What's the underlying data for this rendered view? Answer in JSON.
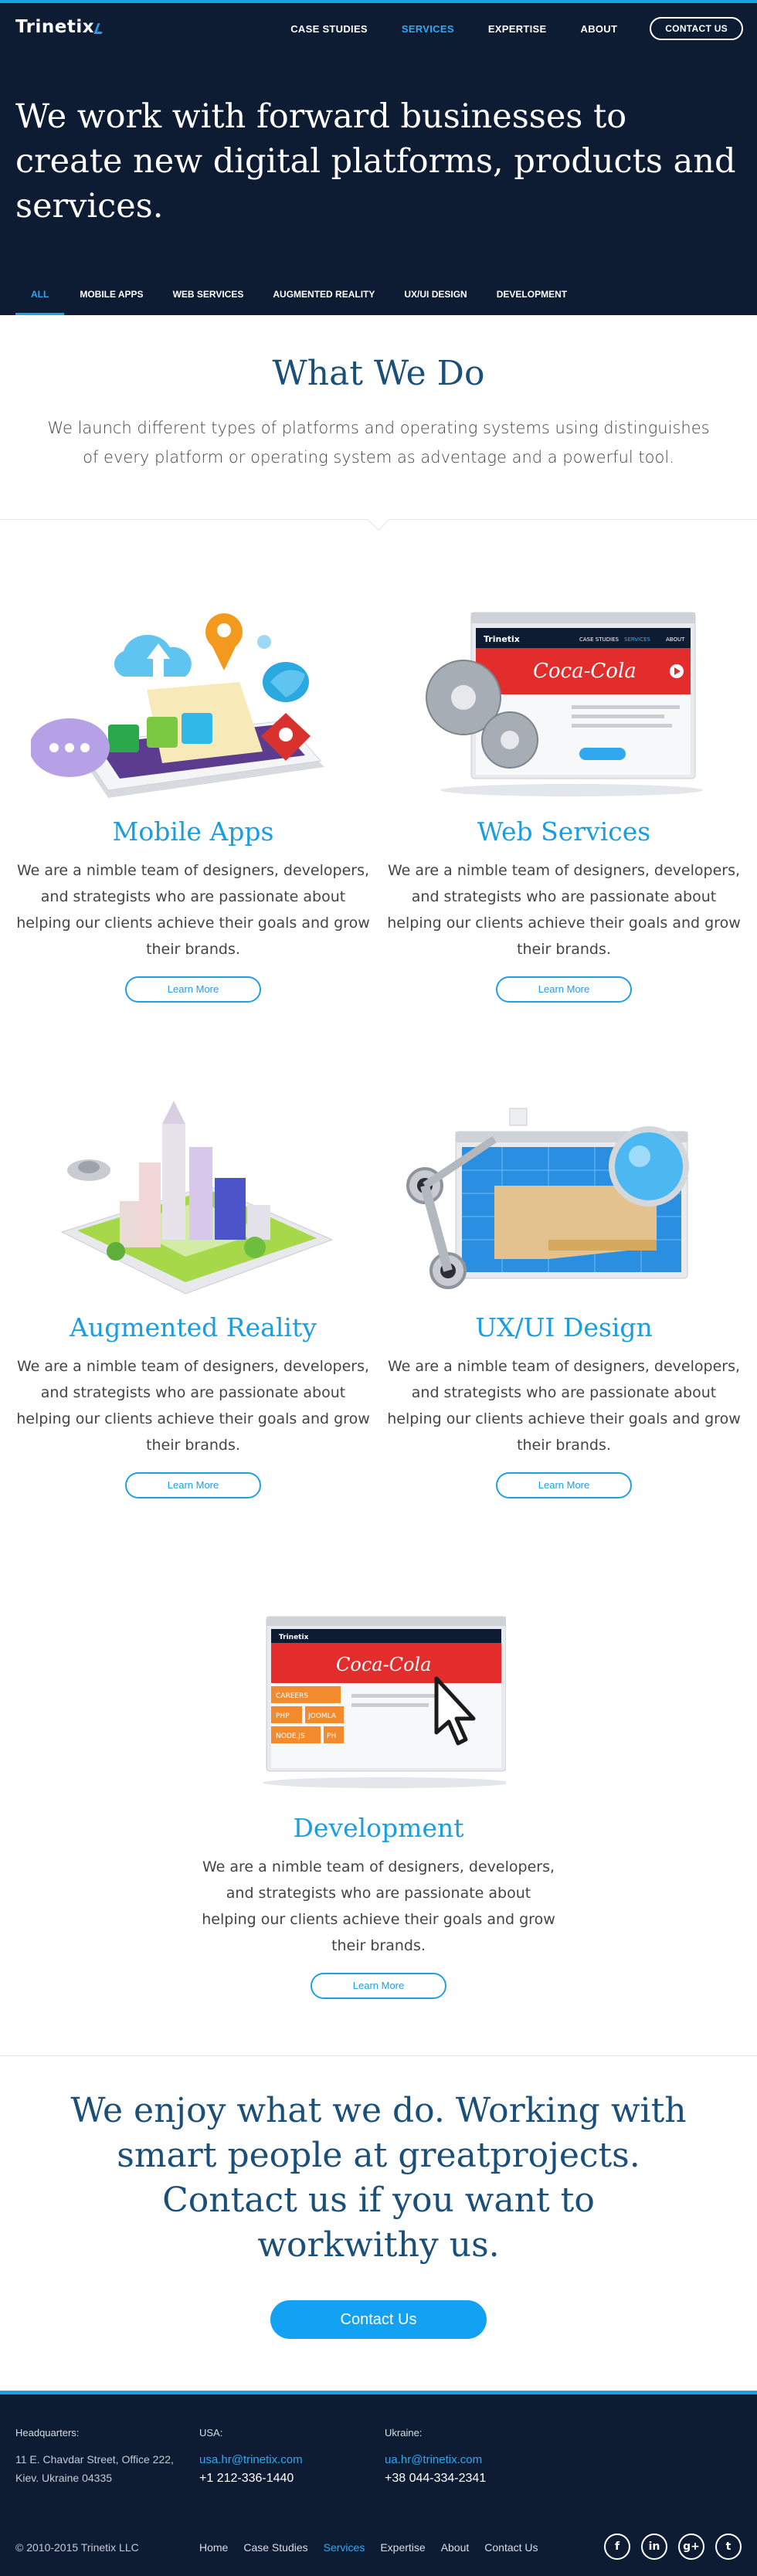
{
  "header": {
    "logo": "Trinetix",
    "nav": [
      {
        "label": "CASE STUDIES",
        "active": false
      },
      {
        "label": "SERVICES",
        "active": true
      },
      {
        "label": "EXPERTISE",
        "active": false
      },
      {
        "label": "ABOUT",
        "active": false
      }
    ],
    "contact_label": "CONTACT US"
  },
  "hero": {
    "title": "We work with forward businesses to create new digital platforms, products and services."
  },
  "filters": [
    {
      "label": "ALL",
      "active": true
    },
    {
      "label": "MOBILE APPS",
      "active": false
    },
    {
      "label": "WEB SERVICES",
      "active": false
    },
    {
      "label": "AUGMENTED REALITY",
      "active": false
    },
    {
      "label": "UX/UI DESIGN",
      "active": false
    },
    {
      "label": "DEVELOPMENT",
      "active": false
    }
  ],
  "what_we_do": {
    "title": "What We Do",
    "text": "We launch different types of platforms and operating systems using distinguishes of every platform or operating system as adventage and a powerful tool."
  },
  "services": [
    {
      "title": "Mobile Apps",
      "text": "We are a nimble team of designers, developers, and strategists who are passionate about helping our clients achieve their goals and grow their brands.",
      "button": "Learn More"
    },
    {
      "title": "Web Services",
      "text": "We are a nimble team of designers, developers, and strategists who are passionate about helping our clients achieve their goals and grow their brands.",
      "button": "Learn More"
    },
    {
      "title": "Augmented Reality",
      "text": "We are a nimble team of designers, developers, and strategists who are passionate about helping our clients achieve their goals and grow their brands.",
      "button": "Learn More"
    },
    {
      "title": "UX/UI Design",
      "text": "We are a nimble team of designers, developers, and strategists who are passionate about helping our clients achieve their goals and grow their brands.",
      "button": "Learn More"
    },
    {
      "title": "Development",
      "text": "We are a nimble team of designers, developers, and strategists who are passionate about helping our clients achieve their goals and grow their brands.",
      "button": "Learn More"
    }
  ],
  "illustration_text": {
    "coca_cola": "Coca-Cola",
    "brand_small": "Trinetix",
    "menu": [
      "CASE STUDIES",
      "SERVICES",
      "ABOUT"
    ],
    "keys": [
      "CAREERS",
      "PHP",
      "JOOMLA",
      "NODE.JS",
      "PH"
    ]
  },
  "enjoy": {
    "title": "We enjoy what we do. Working with smart people at greatprojects. Contact us if you want to workwithy us.",
    "button": "Contact Us"
  },
  "footer": {
    "hq": {
      "label": "Headquarters:",
      "line1": "11 E. Chavdar Street, Office 222,",
      "line2": "Kiev. Ukraine 04335"
    },
    "usa": {
      "label": "USA:",
      "email": "usa.hr@trinetix.com",
      "phone": "+1 212-336-1440"
    },
    "ukraine": {
      "label": "Ukraine:",
      "email": "ua.hr@trinetix.com",
      "phone": "+38 044-334-2341"
    },
    "copyright": "© 2010-2015 Trinetix LLC",
    "nav": [
      {
        "label": "Home",
        "active": false
      },
      {
        "label": "Case Studies",
        "active": false
      },
      {
        "label": "Services",
        "active": true
      },
      {
        "label": "Expertise",
        "active": false
      },
      {
        "label": "About",
        "active": false
      },
      {
        "label": "Contact Us",
        "active": false
      }
    ],
    "social": [
      {
        "icon": "facebook-icon",
        "glyph": "f"
      },
      {
        "icon": "linkedin-icon",
        "glyph": "in"
      },
      {
        "icon": "google-plus-icon",
        "glyph": "g+"
      },
      {
        "icon": "twitter-icon",
        "glyph": "t"
      }
    ]
  },
  "colors": {
    "navy": "#0e1c33",
    "accent": "#1f9fe6",
    "heading_blue": "#1a4f7a",
    "service_blue": "#1a9ee0"
  }
}
